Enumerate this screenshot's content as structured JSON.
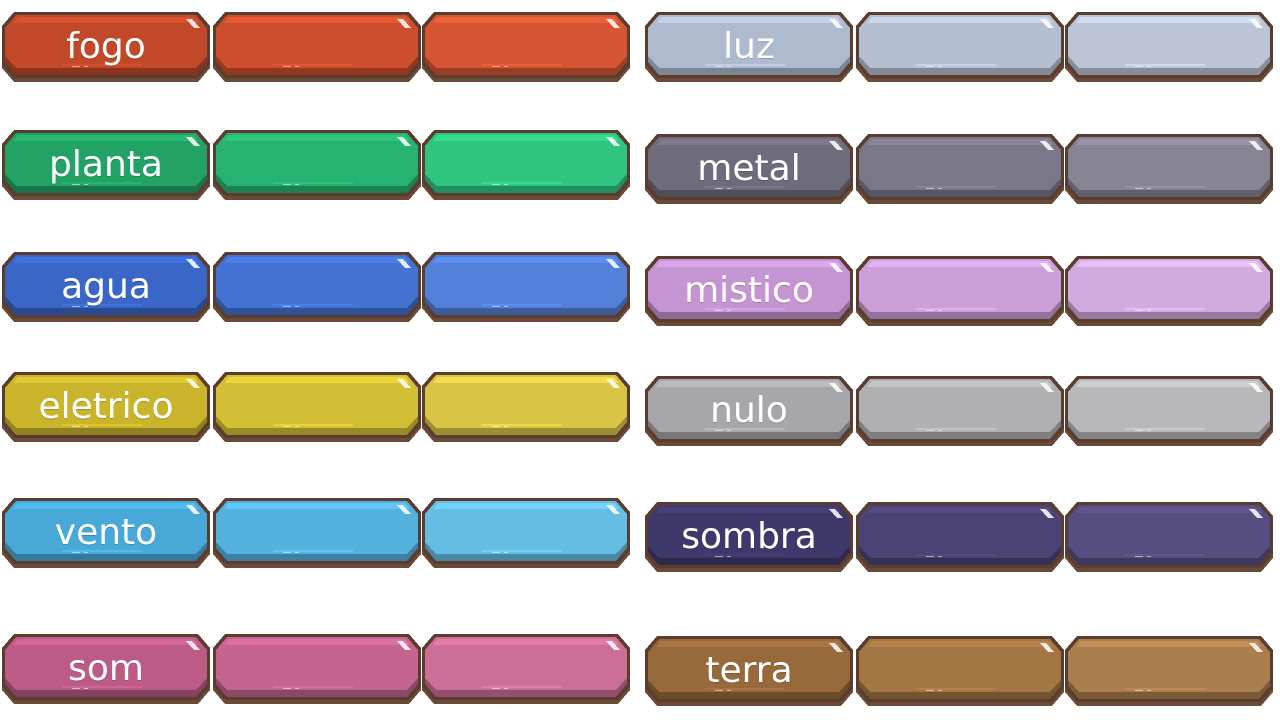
{
  "sheet": {
    "types_left": [
      {
        "label": "fogo",
        "dark": "#c2482a",
        "base": "#cd4e2d",
        "light": "#d65634"
      },
      {
        "label": "planta",
        "dark": "#22a365",
        "base": "#27b271",
        "light": "#2fc581"
      },
      {
        "label": "agua",
        "dark": "#3a67c7",
        "base": "#4372d2",
        "light": "#5380d9"
      },
      {
        "label": "eletrico",
        "dark": "#c9b42c",
        "base": "#d3bf35",
        "light": "#d8c546"
      },
      {
        "label": "vento",
        "dark": "#48a9d9",
        "base": "#55b2df",
        "light": "#66bde3"
      },
      {
        "label": "som",
        "dark": "#bd5b87",
        "base": "#c4648f",
        "light": "#cb6f97"
      }
    ],
    "types_right": [
      {
        "label": "luz",
        "dark": "#aebace",
        "base": "#b4bfd1",
        "light": "#bbc5d6"
      },
      {
        "label": "metal",
        "dark": "#6e6c7c",
        "base": "#7a7888",
        "light": "#878593"
      },
      {
        "label": "mistico",
        "dark": "#c594d2",
        "base": "#cb9fd8",
        "light": "#d1abdd"
      },
      {
        "label": "nulo",
        "dark": "#a7a7ab",
        "base": "#b0b0b3",
        "light": "#b8b8bb"
      },
      {
        "label": "sombra",
        "dark": "#3f386b",
        "base": "#4b4376",
        "light": "#564e81"
      },
      {
        "label": "terra",
        "dark": "#98693a",
        "base": "#a37643",
        "light": "#ab7f4d"
      }
    ]
  }
}
